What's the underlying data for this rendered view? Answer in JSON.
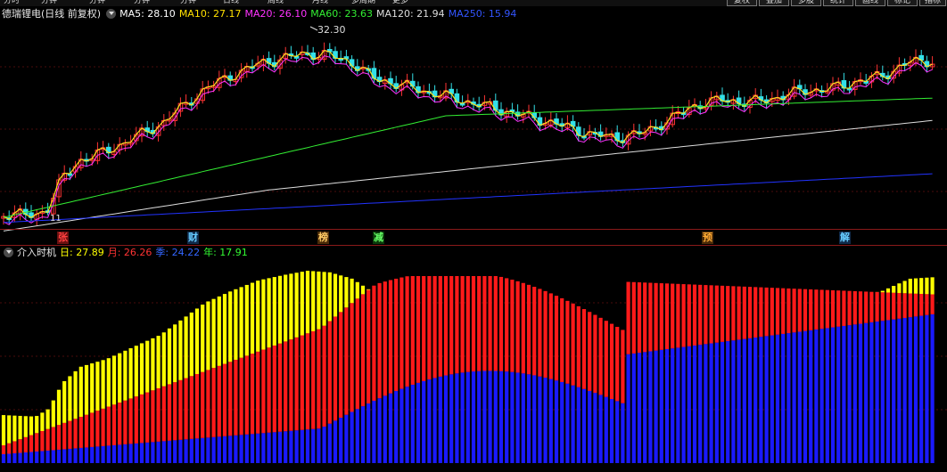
{
  "toolbar": {
    "items": [
      "分时",
      "分钟",
      "分钟",
      "分钟",
      "分钟",
      "日线",
      "周线",
      "月线",
      "多周期",
      "更多"
    ],
    "right_buttons": [
      "复权",
      "叠加",
      "多股",
      "统计",
      "画线",
      "标记"
    ],
    "far_right": "指标"
  },
  "main_panel": {
    "title": "德瑞锂电(日线 前复权)",
    "ma_legend": [
      {
        "label": "MA5: 28.10",
        "color": "#ffffff"
      },
      {
        "label": "MA10: 27.17",
        "color": "#ffe000"
      },
      {
        "label": "MA20: 26.10",
        "color": "#ff33ff"
      },
      {
        "label": "MA60: 23.63",
        "color": "#33ee33"
      },
      {
        "label": "MA120: 21.94",
        "color": "#dddddd"
      },
      {
        "label": "MA250: 15.94",
        "color": "#3355ff"
      }
    ],
    "high_label": "32.30",
    "low_label": "11"
  },
  "event_tags": [
    {
      "label": "张",
      "color": "#ff4040",
      "bg": "#6a1010"
    },
    {
      "label": "财",
      "color": "#66ccff",
      "bg": "#102a4a"
    },
    {
      "label": "榜",
      "color": "#ffcc66",
      "bg": "#4a2a08"
    },
    {
      "label": "减",
      "color": "#66ff66",
      "bg": "#0a3a0a"
    },
    {
      "label": "预",
      "color": "#ffaa33",
      "bg": "#4a2a08"
    },
    {
      "label": "解",
      "color": "#66ccff",
      "bg": "#102a4a"
    }
  ],
  "indicator_panel": {
    "title": "介入时机",
    "legend": [
      {
        "label": "日: 27.89",
        "color": "#ffff00"
      },
      {
        "label": "月: 26.26",
        "color": "#ff3333"
      },
      {
        "label": "季: 24.22",
        "color": "#3366ff"
      },
      {
        "label": "年: 17.91",
        "color": "#33ff33"
      }
    ]
  },
  "colors": {
    "up": "#ff3333",
    "down": "#33e0e8",
    "ma5": "#ffffff",
    "ma10": "#ffe000",
    "ma20": "#ff33ff",
    "ma60": "#33ee33",
    "ma120": "#dddddd",
    "ma250": "#2233ff",
    "yellow": "#ffff00",
    "red": "#ff1a1a",
    "blue": "#1a1aff",
    "green": "#22ff22"
  }
}
